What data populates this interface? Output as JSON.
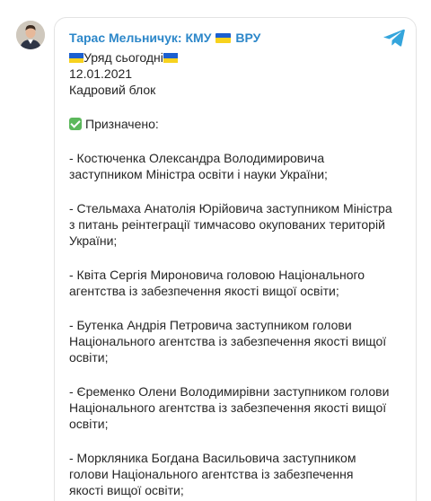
{
  "channel": {
    "name": "Тарас Мельничук: КМУ",
    "suffix": "ВРУ"
  },
  "post": {
    "headline": "Уряд сьогодні",
    "date": "12.01.2021",
    "section": "Кадровий блок",
    "appointed_label": "Призначено:",
    "items": [
      [
        "- Костюченка Олександра Володимировича",
        "заступником Міністра освіти і науки України;"
      ],
      [
        "- Стельмаха Анатолія Юрійовича заступником Міністра",
        "з питань реінтеграції тимчасово окупованих територій",
        "України;"
      ],
      [
        "- Квіта Сергія Мироновича головою Національного",
        "агентства із забезпечення якості вищої освіти;"
      ],
      [
        "- Бутенка Андрія Петровича заступником голови",
        "Національного агентства із забезпечення якості вищої",
        "освіти;"
      ],
      [
        "- Єременко Олени Володимирівни заступником голови",
        "Національного агентства із забезпечення якості вищої",
        "освіти;"
      ],
      [
        "- Моркляника Богдана Васильовича заступником",
        "голови Національного агентства із забезпечення",
        "якості вищої освіти;"
      ]
    ]
  },
  "colors": {
    "channel_name": "#2c87c9",
    "telegram": "#34a5dc",
    "text": "#262626",
    "flag_blue": "#1a5fd0",
    "flag_yellow": "#f7d21e",
    "check_green": "#5cb85c"
  },
  "icons": {
    "avatar": "channel-avatar",
    "telegram": "telegram-plane-icon",
    "flag": "ukraine-flag-icon",
    "check": "check-mark-button-icon"
  }
}
